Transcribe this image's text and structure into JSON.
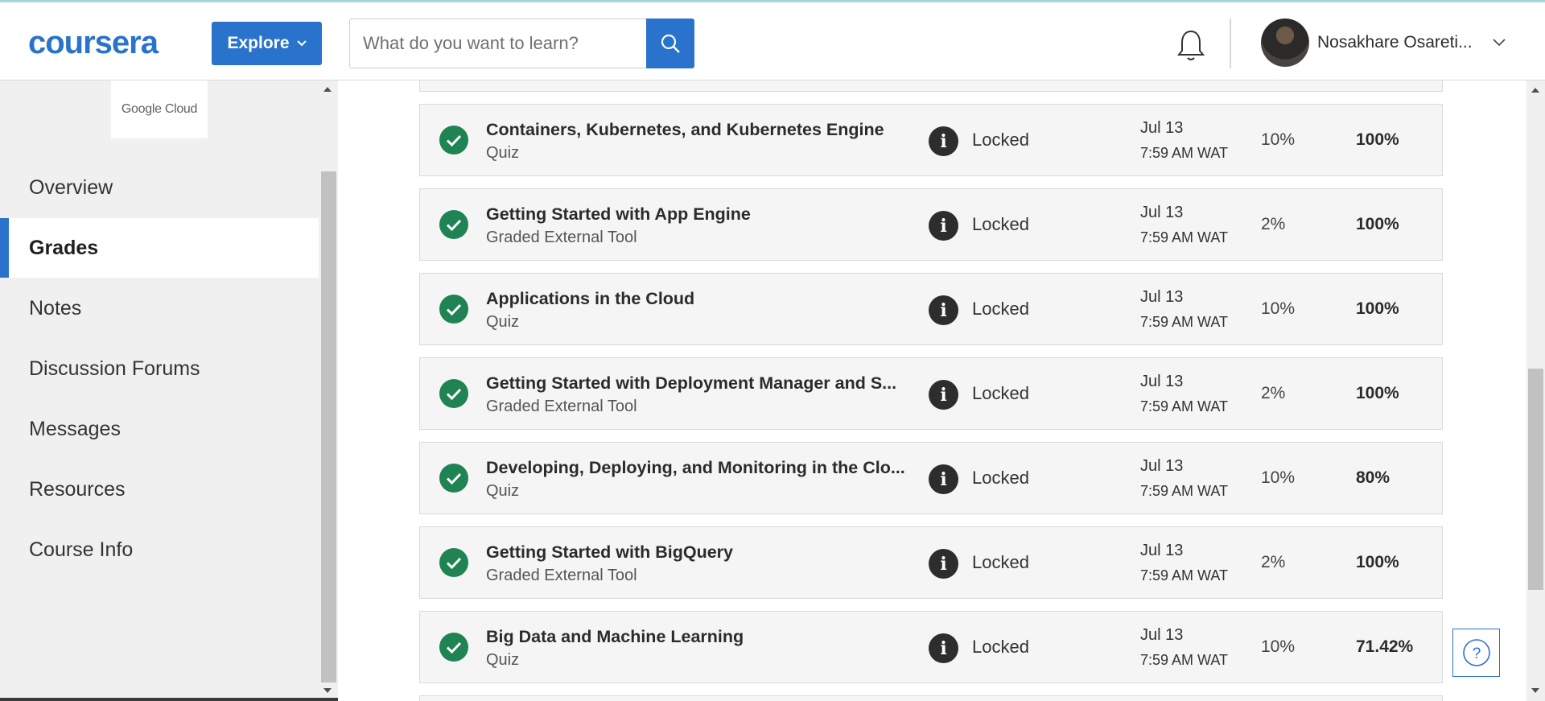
{
  "header": {
    "logo_text": "coursera",
    "explore_label": "Explore",
    "search_placeholder": "What do you want to learn?",
    "username": "Nosakhare Osareti..."
  },
  "sidebar": {
    "partner_logo": "Google Cloud",
    "items": [
      {
        "label": "Overview"
      },
      {
        "label": "Grades"
      },
      {
        "label": "Notes"
      },
      {
        "label": "Discussion Forums"
      },
      {
        "label": "Messages"
      },
      {
        "label": "Resources"
      },
      {
        "label": "Course Info"
      }
    ]
  },
  "grades": [
    {
      "title": "Containers, Kubernetes, and Kubernetes Engine",
      "type": "Quiz",
      "status": "Locked",
      "due_date": "Jul 13",
      "due_time": "7:59 AM WAT",
      "weight": "10%",
      "grade": "100%"
    },
    {
      "title": "Getting Started with App Engine",
      "type": "Graded External Tool",
      "status": "Locked",
      "due_date": "Jul 13",
      "due_time": "7:59 AM WAT",
      "weight": "2%",
      "grade": "100%"
    },
    {
      "title": "Applications in the Cloud",
      "type": "Quiz",
      "status": "Locked",
      "due_date": "Jul 13",
      "due_time": "7:59 AM WAT",
      "weight": "10%",
      "grade": "100%"
    },
    {
      "title": "Getting Started with Deployment Manager and S...",
      "type": "Graded External Tool",
      "status": "Locked",
      "due_date": "Jul 13",
      "due_time": "7:59 AM WAT",
      "weight": "2%",
      "grade": "100%"
    },
    {
      "title": "Developing, Deploying, and Monitoring in the Clo...",
      "type": "Quiz",
      "status": "Locked",
      "due_date": "Jul 13",
      "due_time": "7:59 AM WAT",
      "weight": "10%",
      "grade": "80%"
    },
    {
      "title": "Getting Started with BigQuery",
      "type": "Graded External Tool",
      "status": "Locked",
      "due_date": "Jul 13",
      "due_time": "7:59 AM WAT",
      "weight": "2%",
      "grade": "100%"
    },
    {
      "title": "Big Data and Machine Learning",
      "type": "Quiz",
      "status": "Locked",
      "due_date": "Jul 13",
      "due_time": "7:59 AM WAT",
      "weight": "10%",
      "grade": "71.42%"
    }
  ],
  "help_button": "?",
  "colors": {
    "brand_blue": "#2a73cc",
    "check_green": "#1f8354"
  },
  "icons": [
    "search-icon",
    "bell-icon",
    "chevron-down-icon",
    "check-circle-icon",
    "info-icon",
    "help-icon"
  ]
}
